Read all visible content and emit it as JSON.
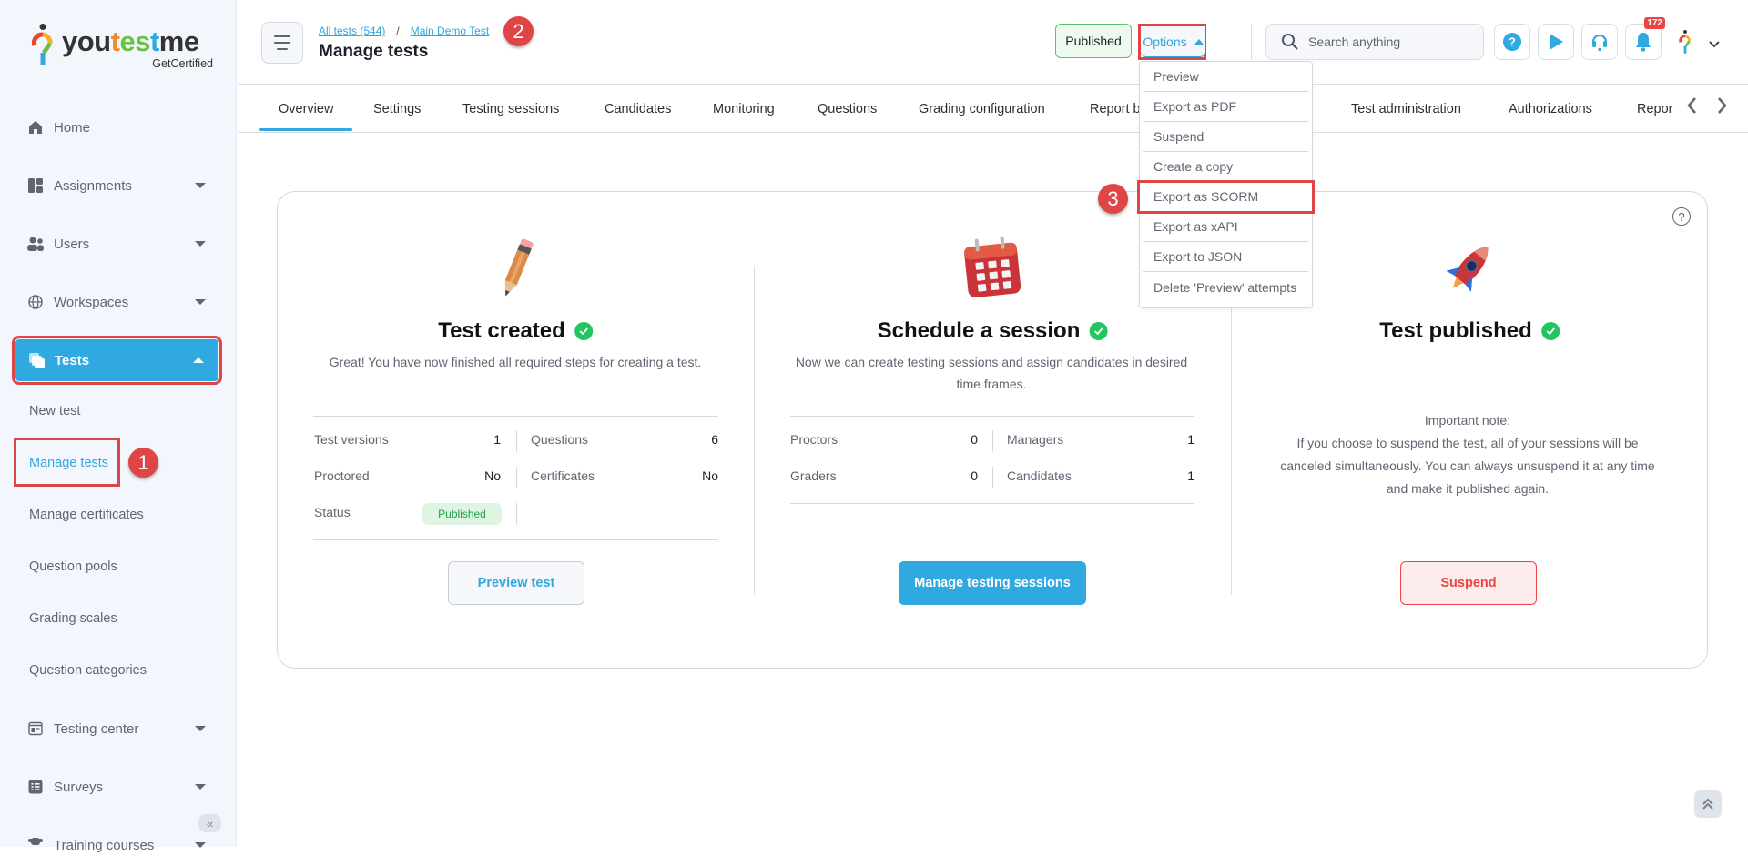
{
  "brand": {
    "word_a": "you",
    "word_b": "t",
    "word_c": "es",
    "word_d": "t",
    "word_e": "me",
    "sub": "GetCertified"
  },
  "sidebar": {
    "items": [
      {
        "label": "Home",
        "icon": "home-icon"
      },
      {
        "label": "Assignments",
        "icon": "assignments-icon"
      },
      {
        "label": "Users",
        "icon": "users-icon"
      },
      {
        "label": "Workspaces",
        "icon": "globe-icon"
      },
      {
        "label": "Tests",
        "icon": "tests-icon",
        "active": true
      },
      {
        "label": "Testing center",
        "icon": "testing-center-icon"
      },
      {
        "label": "Surveys",
        "icon": "surveys-icon"
      },
      {
        "label": "Training courses",
        "icon": "trophy-icon"
      }
    ],
    "sub_items": [
      "New test",
      "Manage tests",
      "Manage certificates",
      "Question pools",
      "Grading scales",
      "Question categories"
    ],
    "current_sub": "Manage tests"
  },
  "annotations": {
    "step1": "1",
    "step2": "2",
    "step3": "3"
  },
  "header": {
    "breadcrumb": {
      "all_tests": "All tests (544)",
      "separator": "/",
      "current": "Main Demo Test"
    },
    "title": "Manage tests",
    "status_button": "Published",
    "options_button": "Options",
    "search_placeholder": "Search anything",
    "notification_count": "172"
  },
  "tabs": [
    "Overview",
    "Settings",
    "Testing sessions",
    "Candidates",
    "Monitoring",
    "Questions",
    "Grading configuration",
    "Report b",
    "Test administration",
    "Authorizations",
    "Repor"
  ],
  "active_tab": "Overview",
  "options_menu": [
    "Preview",
    "Export as PDF",
    "Suspend",
    "Create a copy",
    "Export as SCORM",
    "Export as xAPI",
    "Export to JSON",
    "Delete 'Preview' attempts"
  ],
  "highlighted_option": "Export as SCORM",
  "steps": {
    "created": {
      "title": "Test created",
      "desc": "Great! You have now finished all required steps for creating a test.",
      "stats": {
        "test_versions_label": "Test versions",
        "test_versions": "1",
        "questions_label": "Questions",
        "questions": "6",
        "proctored_label": "Proctored",
        "proctored": "No",
        "certificates_label": "Certificates",
        "certificates": "No",
        "status_label": "Status",
        "status": "Published"
      },
      "button": "Preview test"
    },
    "session": {
      "title": "Schedule a session",
      "desc_line1": "Now we can create testing sessions and assign candidates in desired",
      "desc_line2": "time frames.",
      "stats": {
        "proctors_label": "Proctors",
        "proctors": "0",
        "managers_label": "Managers",
        "managers": "1",
        "graders_label": "Graders",
        "graders": "0",
        "candidates_label": "Candidates",
        "candidates": "1"
      },
      "button": "Manage testing sessions"
    },
    "published": {
      "title": "Test published",
      "note_title": "Important note:",
      "note_line1": "If you choose to suspend the test, all of your sessions will be",
      "note_line2": "canceled simultaneously. You can always unsuspend it at any time",
      "note_line3": "and make it published again.",
      "button": "Suspend"
    }
  },
  "colors": {
    "accent": "#2fa9e0",
    "success": "#22c55e",
    "danger": "#ef4444",
    "annotation": "#e04545"
  }
}
